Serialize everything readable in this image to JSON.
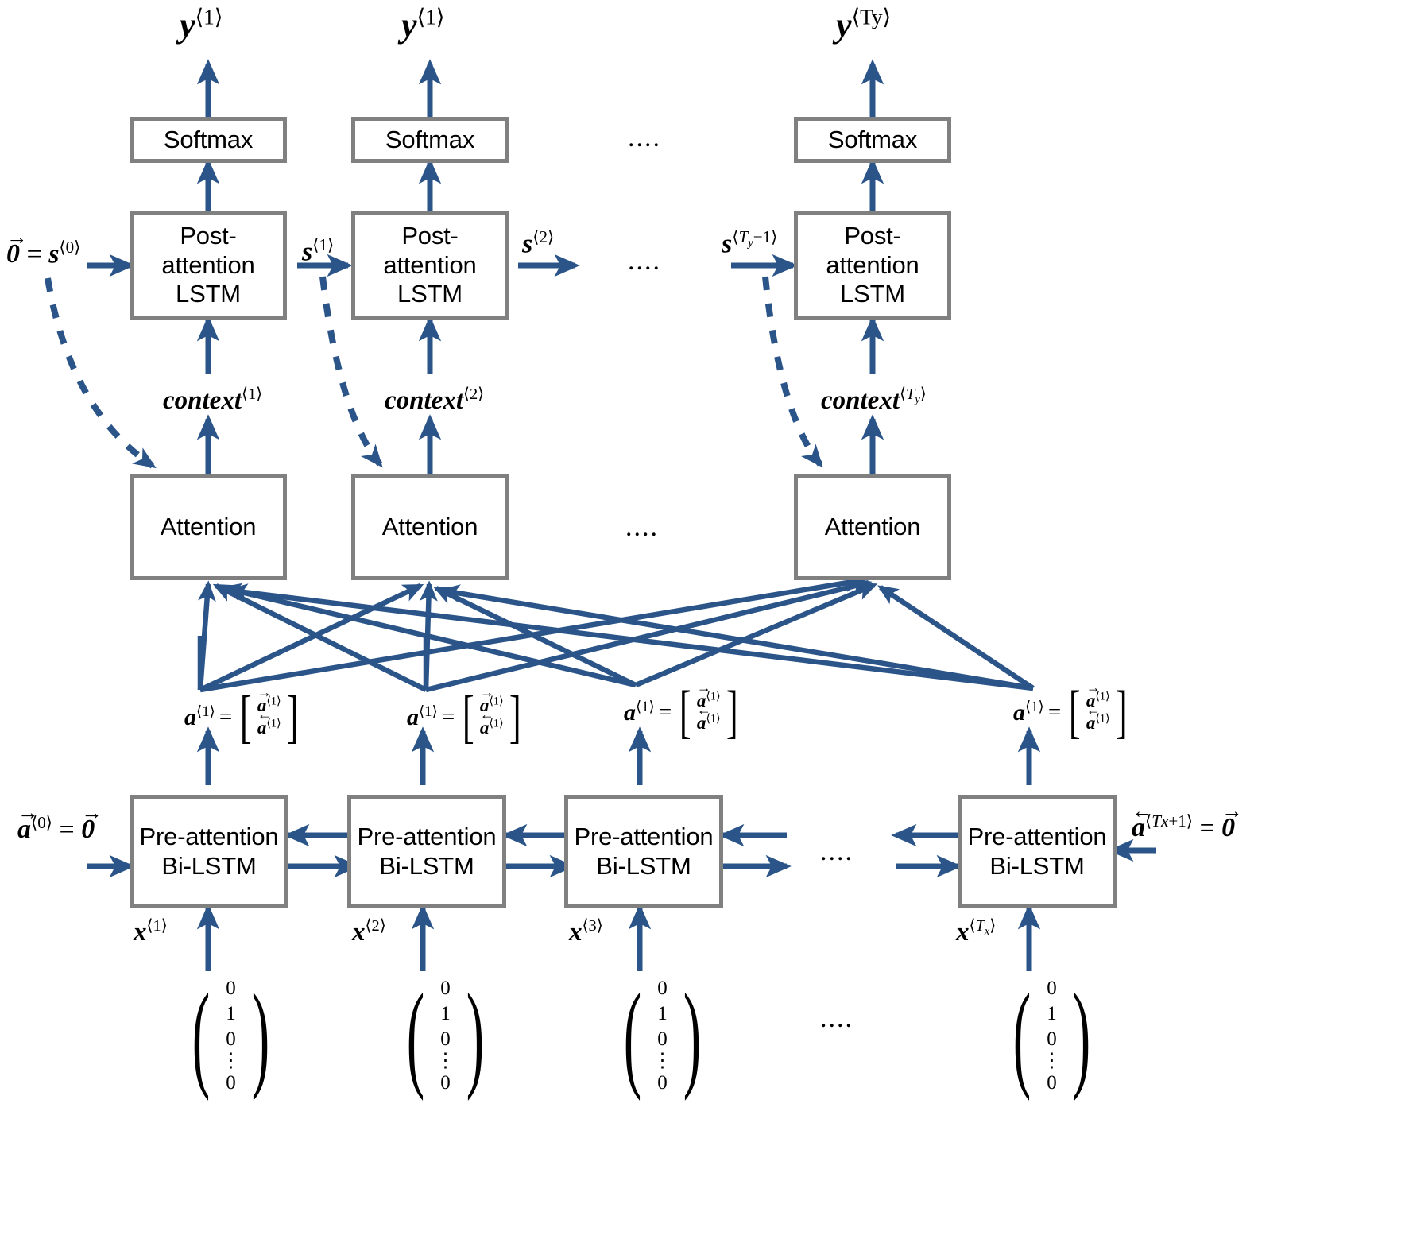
{
  "diagram": {
    "title": "Attention model architecture (neural machine translation)",
    "colors": {
      "arrow": "#2b5489",
      "box_border": "#808080",
      "box_fill": "#ffffff",
      "text": "#000000",
      "page_bg": "#ffffff",
      "outer_bg": "#f2f2f2"
    },
    "ellipsis": "....",
    "boxes": {
      "softmax_label": "Softmax",
      "post_attention_label": "Post-attention\nLSTM",
      "attention_label": "Attention",
      "pre_attention_label": "Pre-attention\nBi-LSTM"
    },
    "columns": [
      {
        "id": "col1",
        "y_label": "y",
        "y_sup": "⟨1⟩",
        "context": "context",
        "context_sup": "⟨1⟩"
      },
      {
        "id": "col2",
        "y_label": "y",
        "y_sup": "⟨1⟩",
        "context": "context",
        "context_sup": "⟨2⟩"
      },
      {
        "id": "colT",
        "y_label": "y",
        "y_sup": "⟨Ty⟩",
        "context": "context",
        "context_sup": "⟨Ty⟩"
      }
    ],
    "state_labels": {
      "s0": "0̅ = s⟨0⟩",
      "s1": "s⟨1⟩",
      "s2": "s⟨2⟩",
      "sTym1": "s⟨Ty−1⟩"
    },
    "activation": {
      "lhs": "a",
      "lhs_sup": "⟨1⟩",
      "equals": "=",
      "row_forward": "a",
      "row_forward_sup": "⟨1⟩",
      "row_backward": "a",
      "row_backward_sup": "⟨1⟩"
    },
    "bilstm_boundary": {
      "left": "a⟨0⟩ = 0",
      "left_arrow_accent": "→",
      "right": "a⟨Tx+1⟩ = 0",
      "right_arrow_accent": "←"
    },
    "inputs": [
      {
        "label": "x",
        "sup": "⟨1⟩"
      },
      {
        "label": "x",
        "sup": "⟨2⟩"
      },
      {
        "label": "x",
        "sup": "⟨3⟩"
      },
      {
        "label": "x",
        "sup": "⟨Tx⟩"
      }
    ],
    "one_hot_vector": {
      "values": [
        "0",
        "1",
        "0",
        "⋮",
        "0"
      ]
    },
    "symbols": {
      "zero": "0",
      "equals": "=",
      "right_arrow": "→",
      "left_arrow": "←",
      "angle_open": "⟨",
      "angle_close": "⟩",
      "Ty": "Ty",
      "Tx": "Tx",
      "Ty_minus_1": "Ty−1",
      "Tx_plus_1": "Tx+1"
    }
  }
}
